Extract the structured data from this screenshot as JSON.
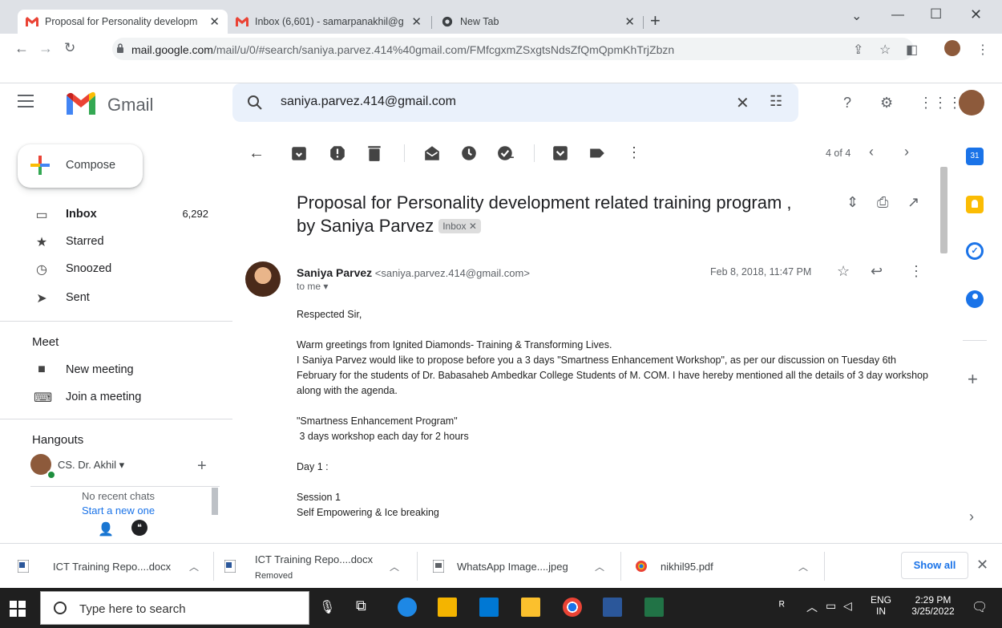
{
  "browser": {
    "tabs": [
      {
        "title": "Proposal for Personality developm",
        "active": true
      },
      {
        "title": "Inbox (6,601) - samarpanakhil@g",
        "active": false
      },
      {
        "title": "New Tab",
        "active": false
      }
    ],
    "url_domain": "mail.google.com",
    "url_path": "/mail/u/0/#search/saniya.parvez.414%40gmail.com/FMfcgxmZSxgtsNdsZfQmQpmKhTrjZbzn"
  },
  "gmail": {
    "logo_text": "Gmail",
    "search_value": "saniya.parvez.414@gmail.com",
    "compose_label": "Compose",
    "nav": [
      {
        "label": "Inbox",
        "count": "6,292",
        "icon": "inbox-icon"
      },
      {
        "label": "Starred",
        "count": "",
        "icon": "star-icon"
      },
      {
        "label": "Snoozed",
        "count": "",
        "icon": "clock-icon"
      },
      {
        "label": "Sent",
        "count": "",
        "icon": "send-icon"
      }
    ],
    "meet": {
      "title": "Meet",
      "items": [
        {
          "label": "New meeting",
          "icon": "video-icon"
        },
        {
          "label": "Join a meeting",
          "icon": "keyboard-icon"
        }
      ]
    },
    "hangouts": {
      "title": "Hangouts",
      "user": "CS. Dr. Akhil",
      "empty": "No recent chats",
      "start": "Start a new one"
    },
    "pager": "4 of 4",
    "message": {
      "subject": "Proposal for Personality development related training program , by Saniya Parvez",
      "label_chip": "Inbox",
      "sender_name": "Saniya Parvez",
      "sender_email": "<saniya.parvez.414@gmail.com>",
      "to": "to me",
      "date": "Feb 8, 2018, 11:47 PM",
      "body": [
        "Respected Sir,",
        "",
        "Warm greetings from Ignited Diamonds- Training & Transforming Lives.",
        "I Saniya Parvez would like to propose before you a 3 days \"Smartness Enhancement Workshop\",  as per our discussion on Tuesday 6th February  for the students of Dr. Babasaheb Ambedkar College Students of M. COM. I have hereby mentioned all the details of 3 day workshop along with the agenda.",
        "",
        "\"Smartness Enhancement Program\"",
        " 3 days workshop each day for 2 hours",
        "",
        "Day 1 :",
        "",
        "Session 1",
        "Self Empowering & Ice breaking"
      ]
    }
  },
  "downloads": {
    "items": [
      {
        "name": "ICT Training Repo....docx",
        "sub": ""
      },
      {
        "name": "ICT Training Repo....docx",
        "sub": "Removed"
      },
      {
        "name": "WhatsApp Image....jpeg",
        "sub": ""
      },
      {
        "name": "nikhil95.pdf",
        "sub": ""
      }
    ],
    "show_all": "Show all"
  },
  "taskbar": {
    "search_placeholder": "Type here to search",
    "lang": "ENG",
    "region": "IN",
    "time": "2:29 PM",
    "date": "3/25/2022"
  },
  "colors": {
    "gmail_red": "#ea4335",
    "accent_blue": "#1a73e8",
    "search_bg": "#eaf1fb"
  }
}
